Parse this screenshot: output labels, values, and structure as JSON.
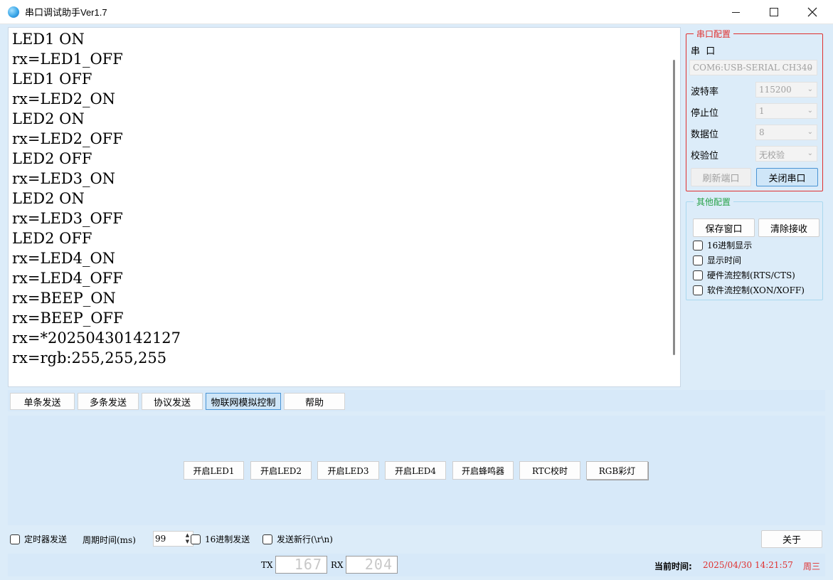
{
  "window": {
    "title": "串口调试助手Ver1.7"
  },
  "receive": {
    "lines": [
      "LED1 ON",
      "rx=LED1_OFF",
      "LED1 OFF",
      "rx=LED2_ON",
      "LED2 ON",
      "rx=LED2_OFF",
      "LED2 OFF",
      "rx=LED3_ON",
      "LED2 ON",
      "rx=LED3_OFF",
      "LED2 OFF",
      "rx=LED4_ON",
      "rx=LED4_OFF",
      "rx=BEEP_ON",
      "rx=BEEP_OFF",
      "rx=*20250430142127",
      "rx=rgb:255,255,255"
    ]
  },
  "serial_config": {
    "legend": "串口配置",
    "port_label": "串  口",
    "port_value": "COM6:USB-SERIAL CH340",
    "baud_label": "波特率",
    "baud_value": "115200",
    "stop_label": "停止位",
    "stop_value": "1",
    "data_label": "数据位",
    "data_value": "8",
    "parity_label": "校验位",
    "parity_value": "无校验",
    "refresh_button": "刷新端口",
    "close_button": "关闭串口"
  },
  "other_config": {
    "legend": "其他配置",
    "save_button": "保存窗口",
    "clear_button": "清除接收",
    "checkboxes": [
      {
        "label": "16进制显示",
        "checked": false
      },
      {
        "label": "显示时间",
        "checked": false
      },
      {
        "label": "硬件流控制(RTS/CTS)",
        "checked": false
      },
      {
        "label": "软件流控制(XON/XOFF)",
        "checked": false
      }
    ]
  },
  "tabs": [
    {
      "label": "单条发送",
      "active": false
    },
    {
      "label": "多条发送",
      "active": false
    },
    {
      "label": "协议发送",
      "active": false
    },
    {
      "label": "物联网模拟控制",
      "active": true
    },
    {
      "label": "帮助",
      "active": false
    }
  ],
  "iot_controls": [
    "开启LED1",
    "开启LED2",
    "开启LED3",
    "开启LED4",
    "开启蜂鸣器",
    "RTC校时",
    "RGB彩灯"
  ],
  "send_options": {
    "timer_send_label": "定时器发送",
    "period_label": "周期时间(ms)",
    "period_value": "99",
    "hex_send_label": "16进制发送",
    "newline_label": "发送新行(\\r\\n)",
    "about_button": "关于"
  },
  "status": {
    "tx_label": "TX",
    "tx_value": "167",
    "rx_label": "RX",
    "rx_value": "204",
    "time_label": "当前时间:",
    "time_value": "2025/04/30 14:21:57",
    "weekday": "周三",
    "accent_color": "#e0302f"
  }
}
